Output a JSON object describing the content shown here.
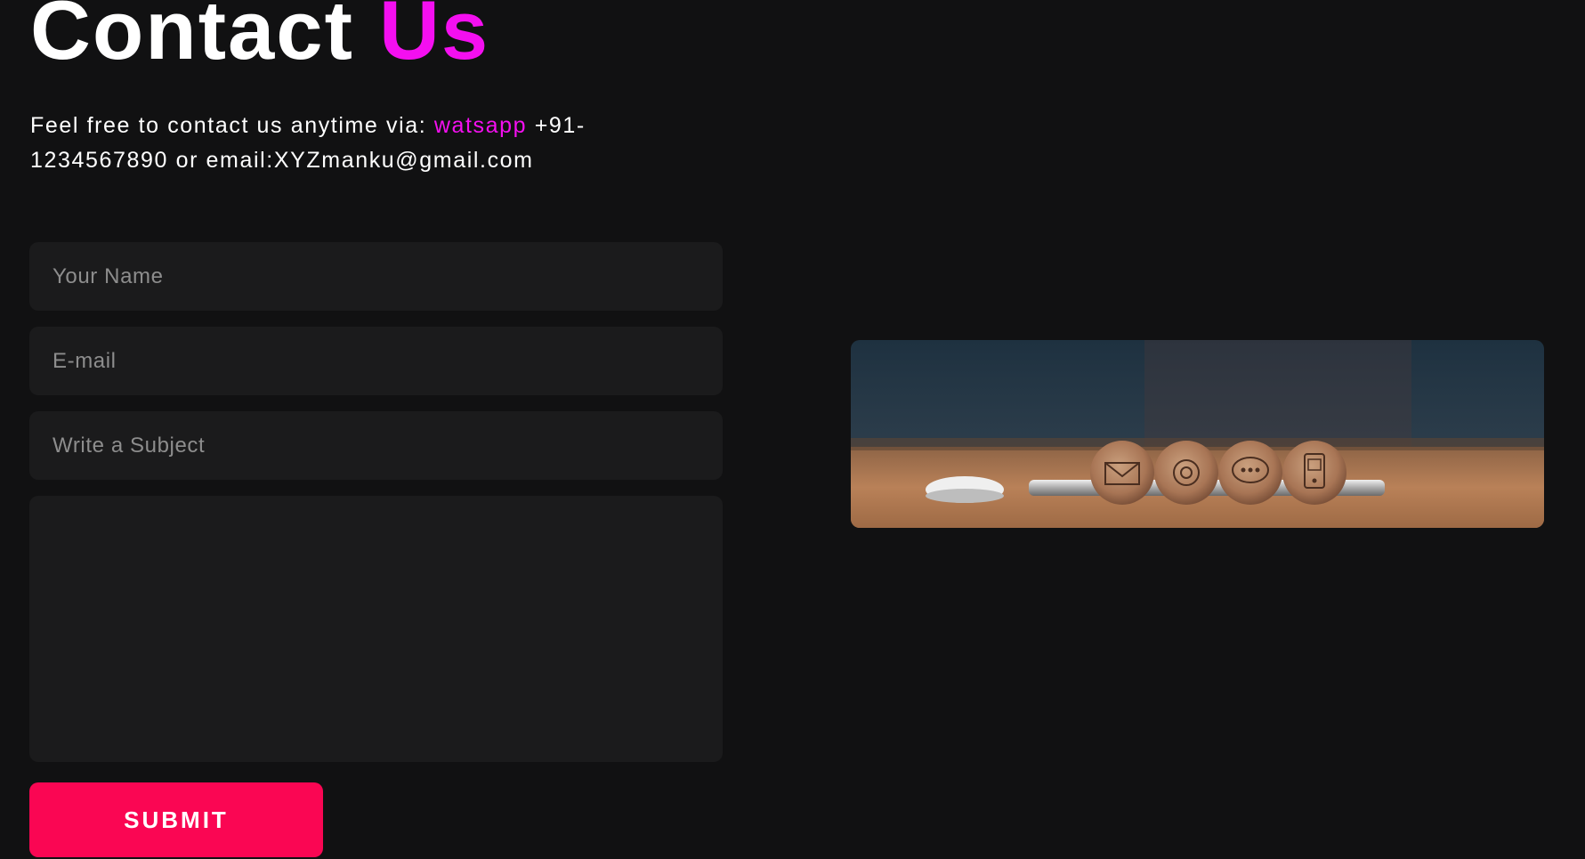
{
  "header": {
    "title_part1": "Contact",
    "title_part2": "Us"
  },
  "intro": {
    "text_before": "Feel free to contact us anytime via: ",
    "whatsapp_link": "watsapp",
    "text_after": " +91-1234567890 or email:XYZmanku@gmail.com"
  },
  "form": {
    "name_placeholder": "Your Name",
    "email_placeholder": "E-mail",
    "subject_placeholder": "Write a Subject",
    "message_placeholder": "",
    "submit_label": "SUBMIT"
  },
  "image": {
    "icons": [
      "mail-icon",
      "at-sign-icon",
      "chat-bubble-icon",
      "mobile-phone-icon"
    ]
  },
  "colors": {
    "background": "#111112",
    "accent": "#f40ff0",
    "button": "#fa0653",
    "field": "#1b1b1c"
  }
}
